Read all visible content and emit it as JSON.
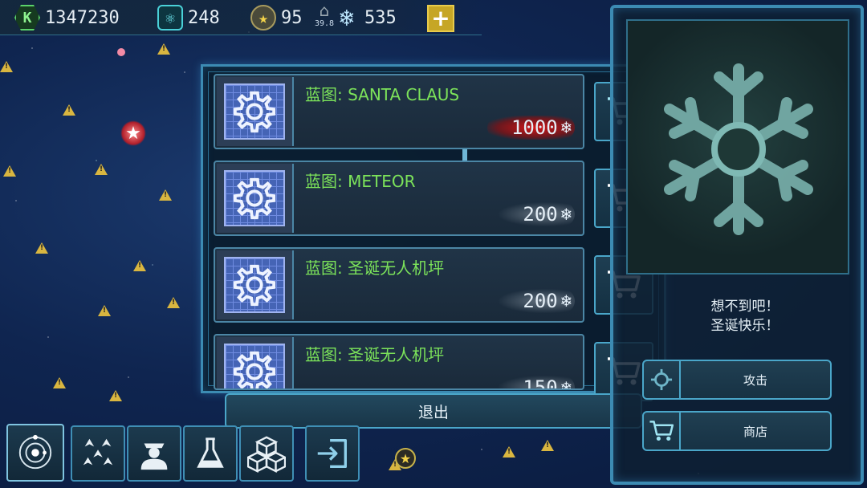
{
  "resources": {
    "credits": "1347230",
    "atoms": "248",
    "stars": "95",
    "home_value": "39.8",
    "snowflakes": "535",
    "plus_label": "+"
  },
  "shop": {
    "items": [
      {
        "title": "蓝图: SANTA CLAUS",
        "price": "1000",
        "highlight": true
      },
      {
        "title": "蓝图: METEOR",
        "price": "200",
        "highlight": false
      },
      {
        "title": "蓝图: 圣诞无人机坪",
        "price": "200",
        "highlight": false
      },
      {
        "title": "蓝图: 圣诞无人机坪",
        "price": "150",
        "highlight": false
      }
    ],
    "exit_label": "退出",
    "currency_glyph": "❄"
  },
  "side_panel": {
    "message_line1": "想不到吧！",
    "message_line2": "圣诞快乐！",
    "attack_label": "攻击",
    "store_label": "商店"
  },
  "icons": {
    "credits": "credits-hex-icon",
    "atoms": "atom-canister-icon",
    "stars": "star-medal-icon",
    "home": "home-icon",
    "snowflake": "snowflake-icon",
    "cart": "shopping-cart-icon",
    "gear": "gear-blueprint-icon"
  },
  "colors": {
    "accent": "#4aa6c9",
    "title_green": "#7ce35a",
    "price_highlight": "#dc1414",
    "plus_gold": "#c6a626"
  }
}
